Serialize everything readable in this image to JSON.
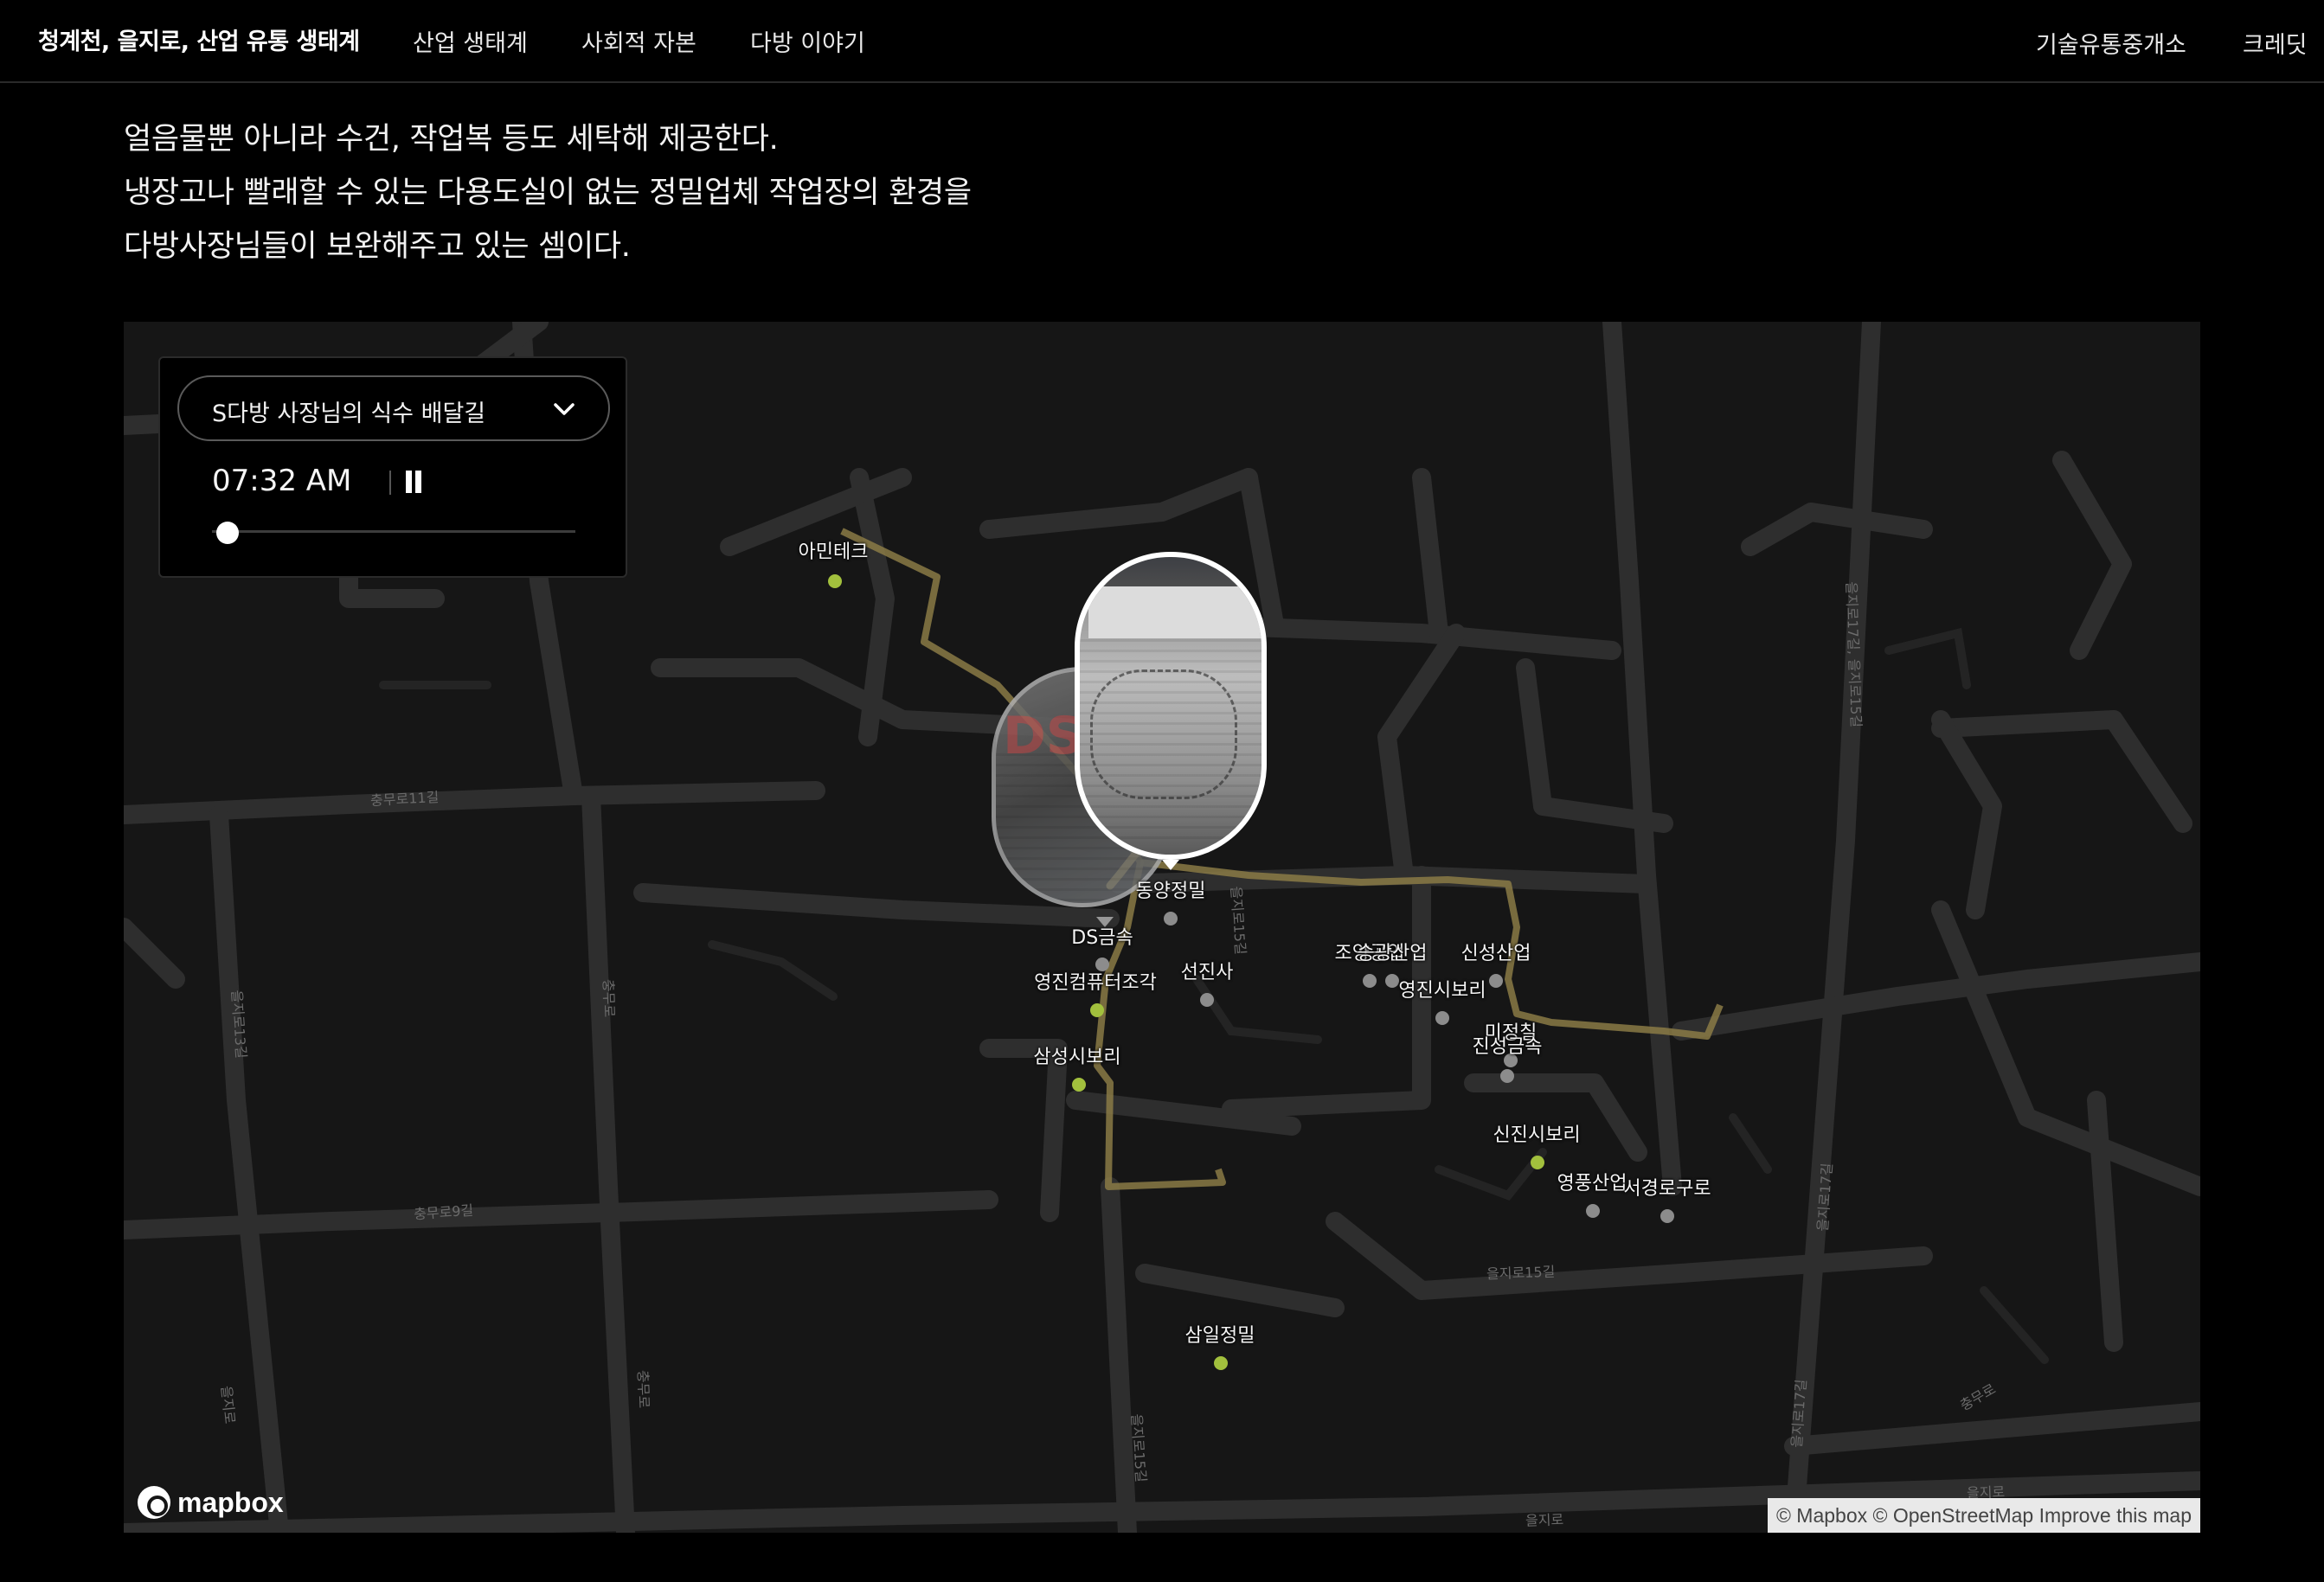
{
  "nav": {
    "brand": "청계천, 을지로, 산업 유통 생태계",
    "items": [
      "산업 생태계",
      "사회적 자본",
      "다방 이야기"
    ],
    "right": [
      "기술유통중개소",
      "크레딧"
    ]
  },
  "intro": {
    "lines": [
      "얼음물뿐 아니라 수건, 작업복 등도 세탁해 제공한다.",
      "냉장고나 빨래할 수 있는 다용도실이 없는 정밀업체 작업장의 환경을",
      "다방사장님들이 보완해주고 있는 셈이다."
    ]
  },
  "panel": {
    "route_select": "S다방 사장님의 식수 배달길",
    "time": "07:32 AM",
    "progress": 0.05
  },
  "pins": [
    {
      "label": "아민테크",
      "color": "green"
    },
    {
      "label": "동양정밀",
      "color": "gray"
    },
    {
      "label": "DS금속",
      "color": "gray"
    },
    {
      "label": "영진컴퓨터조각",
      "color": "green"
    },
    {
      "label": "선진사",
      "color": "gray"
    },
    {
      "label": "삼성시보리",
      "color": "green"
    },
    {
      "label": "조양공업",
      "color": "gray"
    },
    {
      "label": "승광산업",
      "color": "gray"
    },
    {
      "label": "영진시보리",
      "color": "gray"
    },
    {
      "label": "신성산업",
      "color": "gray"
    },
    {
      "label": "미정칠",
      "color": "gray"
    },
    {
      "label": "진성금속",
      "color": "gray"
    },
    {
      "label": "신진시보리",
      "color": "green"
    },
    {
      "label": "영풍산업",
      "color": "gray"
    },
    {
      "label": "서경로구로",
      "color": "gray"
    },
    {
      "label": "삼일정밀",
      "color": "green"
    }
  ],
  "street_labels": [
    "충무로11길",
    "충무로9길",
    "충무로",
    "을지로13길",
    "을지로15길",
    "을지로17길",
    "을지로15길",
    "을지로",
    "을지로",
    "충무로",
    "을지로15길",
    "을지로17길",
    "을지로17길, 을지로15길",
    "충무로",
    "을지로"
  ],
  "attribution": {
    "logo": "mapbox",
    "text": "© Mapbox © OpenStreetMap Improve this map"
  },
  "colors": {
    "background": "#000000",
    "map": "#161616",
    "road": "#2e2e2e",
    "route": "#8a7a45",
    "route_highlight": "#e0c56a",
    "pin_green": "#a2c03d",
    "pin_gray": "#8c8c8c"
  },
  "icons": {
    "dropdown": "chevron-down-icon",
    "playback": "pause-icon"
  }
}
